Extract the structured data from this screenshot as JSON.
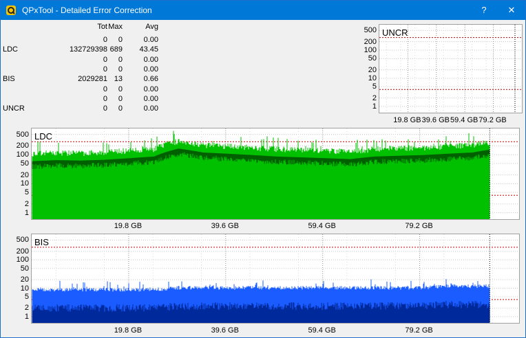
{
  "window": {
    "title": "QPxTool - Detailed Error Correction",
    "help_label": "?",
    "close_label": "✕",
    "icon": "qpxtool-logo-icon"
  },
  "stats": {
    "headers": [
      "Tot",
      "Max",
      "Avg"
    ],
    "rows": [
      {
        "label": "",
        "tot": "0",
        "max": "0",
        "avg": "0.00"
      },
      {
        "label": "LDC",
        "tot": "132729398",
        "max": "689",
        "avg": "43.45"
      },
      {
        "label": "",
        "tot": "0",
        "max": "0",
        "avg": "0.00"
      },
      {
        "label": "",
        "tot": "0",
        "max": "0",
        "avg": "0.00"
      },
      {
        "label": "BIS",
        "tot": "2029281",
        "max": "13",
        "avg": "0.66"
      },
      {
        "label": "",
        "tot": "0",
        "max": "0",
        "avg": "0.00"
      },
      {
        "label": "",
        "tot": "0",
        "max": "0",
        "avg": "0.00"
      },
      {
        "label": "UNCR",
        "tot": "0",
        "max": "0",
        "avg": "0.00"
      }
    ]
  },
  "chart_data": [
    {
      "type": "area",
      "title": "UNCR",
      "y_scale": "log",
      "y_ticks": [
        "500",
        "200",
        "100",
        "50",
        "20",
        "10",
        "5",
        "2",
        "1"
      ],
      "x_ticks": [
        "19.8 GB",
        "39.6 GB",
        "59.4 GB",
        "79.2 GB"
      ],
      "series": [
        {
          "values": [
            0,
            0,
            0,
            0,
            0,
            0,
            0,
            0,
            0,
            0
          ]
        }
      ],
      "colors": {
        "grid": "#a0a0a0",
        "limit": "#c00000"
      }
    },
    {
      "type": "area",
      "title": "LDC",
      "y_scale": "log",
      "y_ticks": [
        "500",
        "200",
        "100",
        "50",
        "20",
        "10",
        "5",
        "2",
        "1"
      ],
      "x_ticks": [
        "19.8 GB",
        "39.6 GB",
        "59.4 GB",
        "79.2 GB"
      ],
      "x": [
        0,
        5,
        10,
        15,
        20,
        25,
        30,
        35,
        40,
        45,
        50,
        55,
        60,
        65,
        70,
        75,
        80,
        85,
        90,
        95
      ],
      "series": [
        {
          "values": [
            55,
            60,
            58,
            62,
            70,
            80,
            150,
            110,
            100,
            90,
            80,
            75,
            70,
            65,
            80,
            85,
            90,
            100,
            110,
            150
          ]
        }
      ],
      "colors": {
        "fill": "#00c000",
        "dark": "#006000",
        "limit": "#c00000"
      }
    },
    {
      "type": "area",
      "title": "BIS",
      "y_scale": "log",
      "y_ticks": [
        "500",
        "200",
        "100",
        "50",
        "20",
        "10",
        "5",
        "2",
        "1"
      ],
      "x_ticks": [
        "19.8 GB",
        "39.6 GB",
        "59.4 GB",
        "79.2 GB"
      ],
      "x": [
        0,
        5,
        10,
        15,
        20,
        25,
        30,
        35,
        40,
        45,
        50,
        55,
        60,
        65,
        70,
        75,
        80,
        85,
        90,
        95
      ],
      "series": [
        {
          "values": [
            6,
            6,
            6,
            6,
            6,
            6,
            7,
            7,
            7,
            7,
            7,
            7,
            7,
            7,
            7,
            7,
            7,
            8,
            8,
            8
          ]
        }
      ],
      "colors": {
        "fill": "#1a5cff",
        "dark": "#002a9c",
        "limit": "#c00000"
      }
    }
  ]
}
